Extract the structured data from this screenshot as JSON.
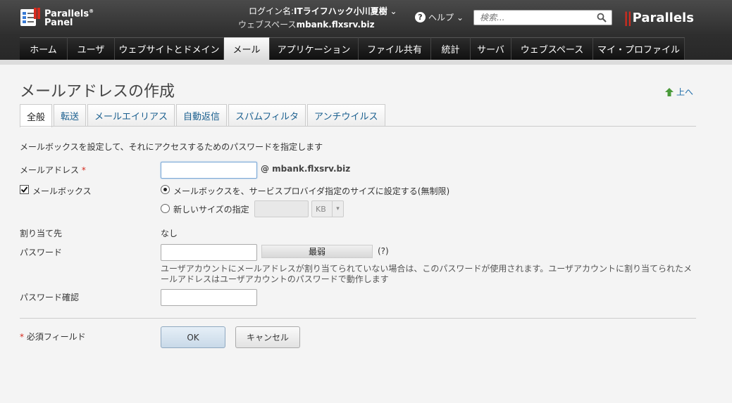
{
  "header": {
    "logo_line1": "Parallels",
    "logo_reg": "®",
    "logo_line2": "Panel",
    "login_label": "ログイン名:",
    "login_user": "ITライフハック小川夏樹",
    "login_caret": "⌄",
    "webspace_label": "ウェブスペース",
    "webspace_value": "mbank.flxsrv.biz",
    "help_label": "ヘルプ",
    "help_caret": "⌄",
    "search_placeholder": "検索...",
    "brand_mark": "||",
    "brand_name": "Parallels",
    "brand_color": "#d52b1e"
  },
  "nav": {
    "tabs": [
      {
        "label": "ホーム",
        "active": false
      },
      {
        "label": "ユーザ",
        "active": false
      },
      {
        "label": "ウェブサイトとドメイン",
        "active": false
      },
      {
        "label": "メール",
        "active": true
      },
      {
        "label": "アプリケーション",
        "active": false
      },
      {
        "label": "ファイル共有",
        "active": false
      },
      {
        "label": "統計",
        "active": false
      },
      {
        "label": "サーバ",
        "active": false
      },
      {
        "label": "ウェブスペース",
        "active": false
      },
      {
        "label": "マイ・プロファイル",
        "active": false
      }
    ]
  },
  "page": {
    "title": "メールアドレスの作成",
    "up_link": "上へ",
    "tabs": [
      "全般",
      "転送",
      "メールエイリアス",
      "自動返信",
      "スパムフィルタ",
      "アンチウイルス"
    ],
    "active_tab": "全般",
    "description": "メールボックスを設定して、それにアクセスするためのパスワードを指定します"
  },
  "form": {
    "email_label": "メールアドレス",
    "required_mark": "*",
    "email_value": "",
    "domain_suffix": "@ mbank.flxsrv.biz",
    "mailbox_label": "メールボックス",
    "mailbox_checked": true,
    "size_default_label": "メールボックスを、サービスプロバイダ指定のサイズに設定する(無制限)",
    "size_custom_label": "新しいサイズの指定",
    "size_unit": "KB",
    "size_unit_arrow": "▾",
    "assign_label": "割り当て先",
    "assign_value": "なし",
    "password_label": "パスワード",
    "password_strength": "最弱",
    "password_help": "(?)",
    "password_note": "ユーザアカウントにメールアドレスが割り当てられていない場合は、このパスワードが使用されます。ユーザアカウントに割り当てられたメールアドレスはユーザアカウントのパスワードで動作します",
    "confirm_label": "パスワード確認",
    "required_note": "必須フィールド",
    "ok_label": "OK",
    "cancel_label": "キャンセル"
  }
}
